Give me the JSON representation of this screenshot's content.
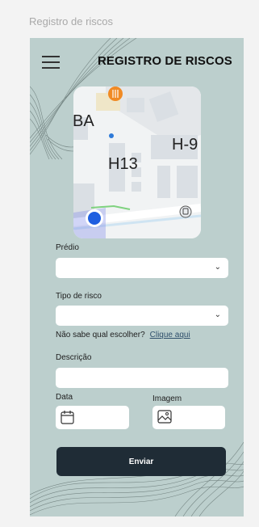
{
  "frame_label": "Registro de riscos",
  "header": {
    "title": "REGISTRO DE RISCOS",
    "menu_icon": "hamburger-menu-icon"
  },
  "map": {
    "labels": {
      "ba": "BA",
      "h13": "H13",
      "h9": "H-9"
    },
    "icons": [
      "restaurant-pin-icon",
      "current-location-icon",
      "transit-icon"
    ]
  },
  "form": {
    "predio": {
      "label": "Prédio",
      "value": ""
    },
    "tipo_risco": {
      "label": "Tipo de risco",
      "value": ""
    },
    "help": {
      "text": "Não sabe qual escolher?",
      "link": "Clique aqui"
    },
    "descricao": {
      "label": "Descrição",
      "value": ""
    },
    "data": {
      "label": "Data",
      "icon": "calendar-icon"
    },
    "imagem": {
      "label": "Imagem",
      "icon": "image-icon"
    },
    "submit_label": "Enviar"
  },
  "colors": {
    "panel": "#bccfcd",
    "button": "#1f2c36",
    "accent": "#2f4f6b"
  }
}
